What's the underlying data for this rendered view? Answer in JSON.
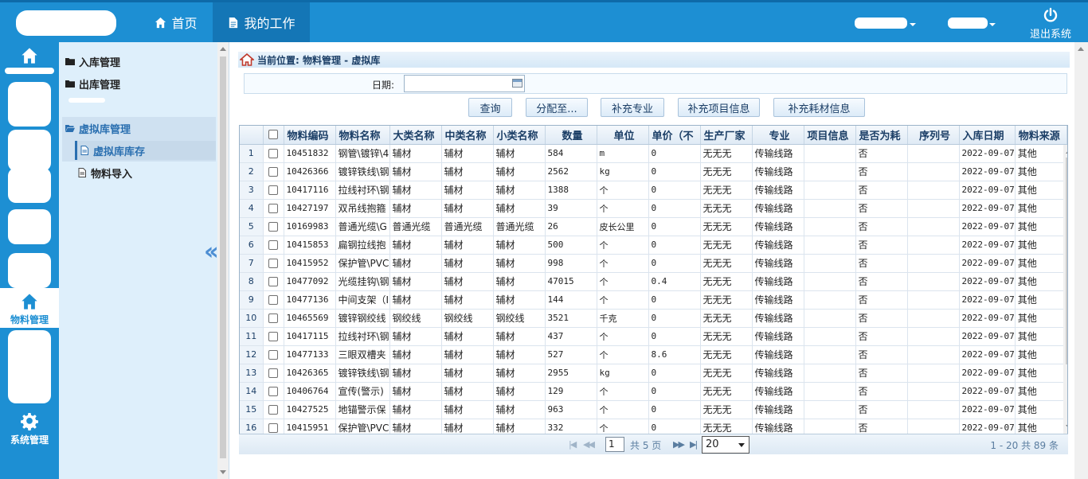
{
  "header": {
    "nav": [
      {
        "label": "首页",
        "icon": "home-icon"
      },
      {
        "label": "我的工作",
        "icon": "document-icon"
      }
    ],
    "logout_label": "退出系统"
  },
  "rail": {
    "active_label": "物料管理",
    "settings_label": "系统管理"
  },
  "submenu": {
    "items": [
      {
        "label": "入库管理"
      },
      {
        "label": "出库管理"
      },
      {
        "label": "虚拟库管理"
      },
      {
        "label": "虚拟库库存"
      },
      {
        "label": "物料导入"
      }
    ]
  },
  "breadcrumb": "当前位置: 物料管理 - 虚拟库",
  "filter": {
    "date_label": "日期:",
    "date_value": ""
  },
  "buttons": [
    "查询",
    "分配至...",
    "补充专业",
    "补充项目信息",
    "补充耗材信息"
  ],
  "grid": {
    "columns": [
      "物料编码",
      "物料名称",
      "大类名称",
      "中类名称",
      "小类名称",
      "数量",
      "单位",
      "单价（不",
      "生产厂家",
      "专业",
      "项目信息",
      "是否为耗",
      "序列号",
      "入库日期",
      "物料来源"
    ],
    "rows": [
      [
        "1",
        "10451832",
        "钢管\\镀锌\\4",
        "辅材",
        "辅材",
        "辅材",
        "584",
        "m",
        "0",
        "无无无",
        "传输线路",
        "",
        "否",
        "",
        "2022-09-07",
        "其他"
      ],
      [
        "2",
        "10426366",
        "镀锌铁线\\钢",
        "辅材",
        "辅材",
        "辅材",
        "2562",
        "kg",
        "0",
        "无无无",
        "传输线路",
        "",
        "否",
        "",
        "2022-09-07",
        "其他"
      ],
      [
        "3",
        "10417116",
        "拉线衬环\\钢",
        "辅材",
        "辅材",
        "辅材",
        "1388",
        "个",
        "0",
        "无无无",
        "传输线路",
        "",
        "否",
        "",
        "2022-09-07",
        "其他"
      ],
      [
        "4",
        "10427197",
        "双吊线抱箍",
        "辅材",
        "辅材",
        "辅材",
        "39",
        "个",
        "0",
        "无无无",
        "传输线路",
        "",
        "否",
        "",
        "2022-09-07",
        "其他"
      ],
      [
        "5",
        "10169983",
        "普通光缆\\G",
        "普通光缆",
        "普通光缆",
        "普通光缆",
        "26",
        "皮长公里",
        "0",
        "无无无",
        "传输线路",
        "",
        "否",
        "",
        "2022-09-07",
        "其他"
      ],
      [
        "6",
        "10415853",
        "扁钢拉线抱",
        "辅材",
        "辅材",
        "辅材",
        "500",
        "个",
        "0",
        "无无无",
        "传输线路",
        "",
        "否",
        "",
        "2022-09-07",
        "其他"
      ],
      [
        "7",
        "10415952",
        "保护管\\PVC",
        "辅材",
        "辅材",
        "辅材",
        "998",
        "个",
        "0",
        "无无无",
        "传输线路",
        "",
        "否",
        "",
        "2022-09-07",
        "其他"
      ],
      [
        "8",
        "10477092",
        "光缆挂钩\\钢",
        "辅材",
        "辅材",
        "辅材",
        "47015",
        "个",
        "0.4",
        "无无无",
        "传输线路",
        "",
        "否",
        "",
        "2022-09-07",
        "其他"
      ],
      [
        "9",
        "10477136",
        "中间支架（I",
        "辅材",
        "辅材",
        "辅材",
        "144",
        "个",
        "0",
        "无无无",
        "传输线路",
        "",
        "否",
        "",
        "2022-09-07",
        "其他"
      ],
      [
        "10",
        "10465569",
        "镀锌钢绞线",
        "钢绞线",
        "钢绞线",
        "钢绞线",
        "3521",
        "千克",
        "0",
        "无无无",
        "传输线路",
        "",
        "否",
        "",
        "2022-09-07",
        "其他"
      ],
      [
        "11",
        "10417115",
        "拉线衬环\\钢",
        "辅材",
        "辅材",
        "辅材",
        "437",
        "个",
        "0",
        "无无无",
        "传输线路",
        "",
        "否",
        "",
        "2022-09-07",
        "其他"
      ],
      [
        "12",
        "10477133",
        "三眼双槽夹",
        "辅材",
        "辅材",
        "辅材",
        "527",
        "个",
        "8.6",
        "无无无",
        "传输线路",
        "",
        "否",
        "",
        "2022-09-07",
        "其他"
      ],
      [
        "13",
        "10426365",
        "镀锌铁线\\钢",
        "辅材",
        "辅材",
        "辅材",
        "2955",
        "kg",
        "0",
        "无无无",
        "传输线路",
        "",
        "否",
        "",
        "2022-09-07",
        "其他"
      ],
      [
        "14",
        "10406764",
        "宣传(警示)",
        "辅材",
        "辅材",
        "辅材",
        "129",
        "个",
        "0",
        "无无无",
        "传输线路",
        "",
        "否",
        "",
        "2022-09-07",
        "其他"
      ],
      [
        "15",
        "10427525",
        "地锚警示保",
        "辅材",
        "辅材",
        "辅材",
        "963",
        "个",
        "0",
        "无无无",
        "传输线路",
        "",
        "否",
        "",
        "2022-09-07",
        "其他"
      ],
      [
        "16",
        "10415951",
        "保护管\\PVC",
        "辅材",
        "辅材",
        "辅材",
        "332",
        "个",
        "0",
        "无无无",
        "传输线路",
        "",
        "否",
        "",
        "2022-09-07",
        "其他"
      ]
    ]
  },
  "pager": {
    "page": "1",
    "total_pages_text": "共 5 页",
    "page_size": "20",
    "range_text": "1 - 20  共 89 条"
  }
}
